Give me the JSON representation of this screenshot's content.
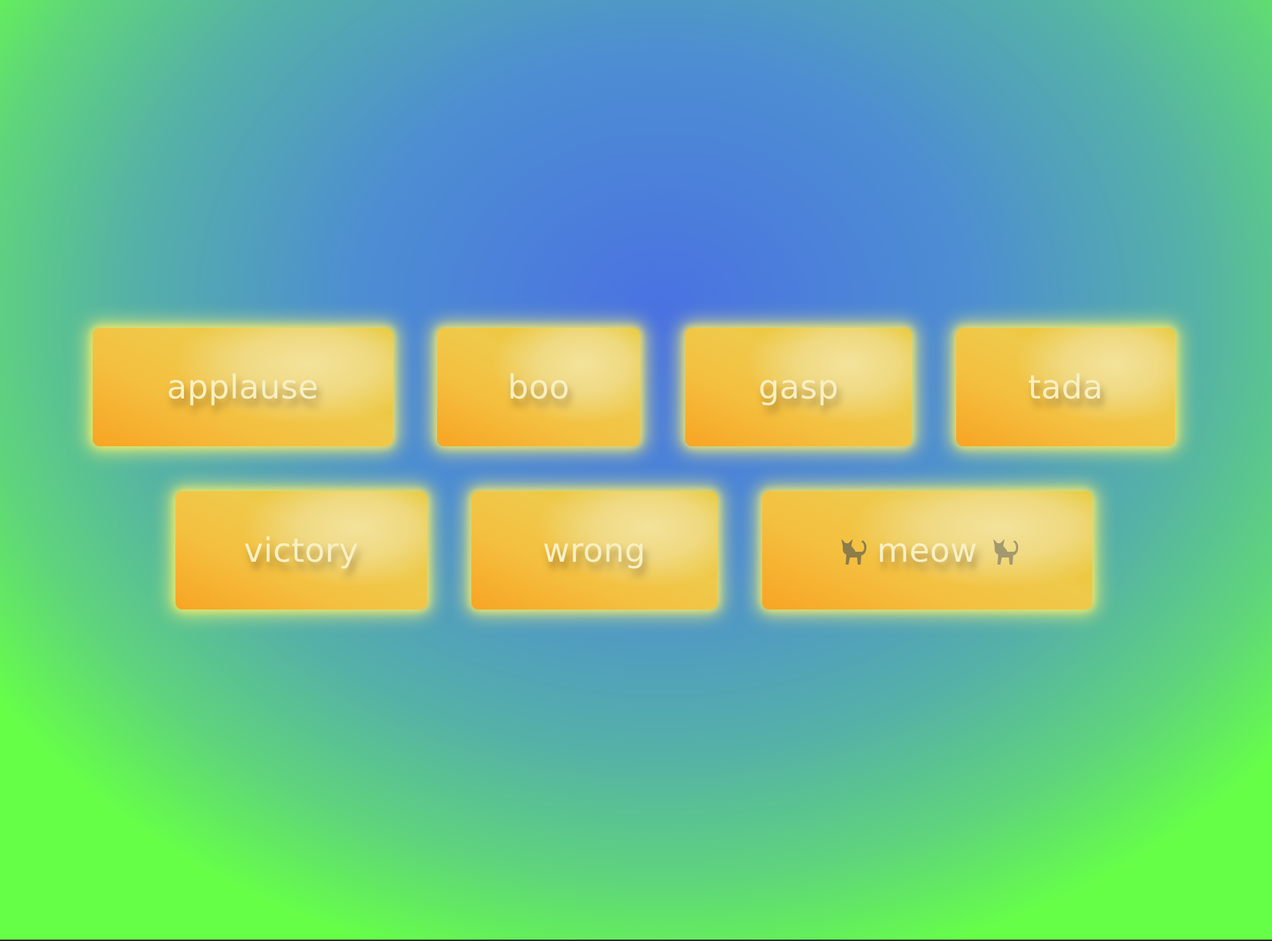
{
  "buttons": {
    "applause": {
      "label": "applause"
    },
    "boo": {
      "label": "boo"
    },
    "gasp": {
      "label": "gasp"
    },
    "tada": {
      "label": "tada"
    },
    "victory": {
      "label": "victory"
    },
    "wrong": {
      "label": "wrong"
    },
    "meow": {
      "label": "meow",
      "icon": "cat-icon"
    }
  },
  "colors": {
    "background_center": "#4a72e2",
    "background_edge": "#66ff48",
    "button_yellow": "#f4c040",
    "button_orange": "#f8a423",
    "button_text": "#f8f0c4",
    "glow": "#fff470"
  }
}
